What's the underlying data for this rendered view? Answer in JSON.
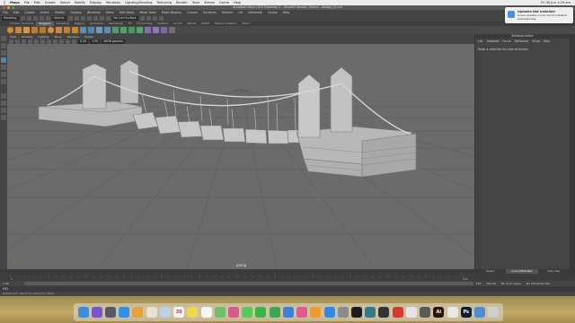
{
  "mac_menubar": {
    "apple": "",
    "app": "Maya",
    "items": [
      "File",
      "Edit",
      "Create",
      "Select",
      "Modify",
      "Display",
      "Windows",
      "Lighting/Shading",
      "Texturing",
      "Render",
      "Toon",
      "Stereo",
      "Cache",
      "Help"
    ],
    "clock": "Fri 30 Jun 1:29 am"
  },
  "window": {
    "title": "Autodesk Maya 2016 Extension 2 – Student Version: /Users/.../bridge_01.mb"
  },
  "maya_menus": [
    "File",
    "Edit",
    "Create",
    "Select",
    "Modify",
    "Display",
    "Windows",
    "Mesh",
    "Edit Mesh",
    "Mesh Tools",
    "Mesh Display",
    "Curves",
    "Surfaces",
    "Deform",
    "UV",
    "Generate",
    "Cache",
    "Help"
  ],
  "status_line": {
    "mode": "Modeling",
    "object_field": "Objects",
    "live": "No Live Surface"
  },
  "shelf_tabs": {
    "items": [
      "Curves / Surfaces",
      "Polygons",
      "Sculpting",
      "Rigging",
      "Animation",
      "Rendering",
      "FX",
      "FX Caching",
      "Custom",
      "Arnold",
      "Bifrost",
      "MASH",
      "Motion Graphics",
      "XGen"
    ],
    "active": 1
  },
  "panel_menu": [
    "View",
    "Shading",
    "Lighting",
    "Show",
    "Renderer",
    "Panels"
  ],
  "panel_toolbar": {
    "gamma": "sRGB gamma",
    "value_a": "0.00",
    "value_b": "1.00"
  },
  "viewport": {
    "label": "persp"
  },
  "attribute_editor": {
    "title": "Attribute Editor",
    "menu": [
      "List",
      "Selected",
      "Focus",
      "Attributes",
      "Show",
      "Help"
    ],
    "message": "Make a selection to view attributes.",
    "tabs": [
      "Select",
      "Load Attributes",
      "Copy Tab"
    ],
    "active_tab": 1
  },
  "timeline": {
    "start": "1",
    "end": "120",
    "range_start": "1.00",
    "range_end": "120",
    "playback_end": "200.00",
    "anim_layer": "No Anim Layer",
    "char_set": "No Character Set"
  },
  "command_line": {
    "label": "MEL"
  },
  "help_line": "Rotate Tool: Select an object to rotate.",
  "notification": {
    "title": "Updates Not Installed",
    "body": "Some updates could not be installed automatically."
  },
  "dock": {
    "items": [
      {
        "name": "finder-icon",
        "color": "#3b8ede",
        "glyph": ""
      },
      {
        "name": "siri-icon",
        "color": "#7a52c9",
        "glyph": ""
      },
      {
        "name": "launchpad-icon",
        "color": "#555a66",
        "glyph": ""
      },
      {
        "name": "safari-icon",
        "color": "#2e8fe6",
        "glyph": ""
      },
      {
        "name": "chrome-icon",
        "color": "#e2a33c",
        "glyph": ""
      },
      {
        "name": "photos-icon",
        "color": "#e9e0d0",
        "glyph": ""
      },
      {
        "name": "mail-icon",
        "color": "#bcd1e8",
        "glyph": ""
      },
      {
        "name": "calendar-icon",
        "color": "#f5f5f5",
        "glyph": "30"
      },
      {
        "name": "notes-icon",
        "color": "#f0d84c",
        "glyph": ""
      },
      {
        "name": "reminders-icon",
        "color": "#f5f5f5",
        "glyph": ""
      },
      {
        "name": "maps-icon",
        "color": "#6fbf6a",
        "glyph": ""
      },
      {
        "name": "photos2-icon",
        "color": "#d65a8c",
        "glyph": ""
      },
      {
        "name": "messages-icon",
        "color": "#55c95a",
        "glyph": ""
      },
      {
        "name": "facetime-icon",
        "color": "#3bb548",
        "glyph": ""
      },
      {
        "name": "numbers-icon",
        "color": "#3aa653",
        "glyph": ""
      },
      {
        "name": "keynote-icon",
        "color": "#3d7fd9",
        "glyph": ""
      },
      {
        "name": "itunes-icon",
        "color": "#e45b8a",
        "glyph": ""
      },
      {
        "name": "ibooks-icon",
        "color": "#f09a2c",
        "glyph": ""
      },
      {
        "name": "appstore-icon",
        "color": "#2f8ae5",
        "glyph": ""
      },
      {
        "name": "preferences-icon",
        "color": "#8a8a8a",
        "glyph": ""
      },
      {
        "name": "spotify-icon",
        "color": "#1c1c1c",
        "glyph": ""
      },
      {
        "name": "maya-icon",
        "color": "#2e7d86",
        "glyph": ""
      },
      {
        "name": "unity-icon",
        "color": "#333333",
        "glyph": ""
      },
      {
        "name": "airmail-icon",
        "color": "#d63a2f",
        "glyph": ""
      },
      {
        "name": "pen-icon",
        "color": "#e4e4e4",
        "glyph": ""
      },
      {
        "name": "grapher-icon",
        "color": "#5a5a5a",
        "glyph": ""
      },
      {
        "name": "illustrator-icon",
        "color": "#2b1408",
        "glyph": "Ai"
      },
      {
        "name": "preview-icon",
        "color": "#e8e8e8",
        "glyph": ""
      },
      {
        "name": "photoshop-icon",
        "color": "#0c1f33",
        "glyph": "Ps"
      },
      {
        "name": "downloads-icon",
        "color": "#4a8fd6",
        "glyph": ""
      },
      {
        "name": "trash-icon",
        "color": "#cfcfcf",
        "glyph": ""
      }
    ]
  }
}
